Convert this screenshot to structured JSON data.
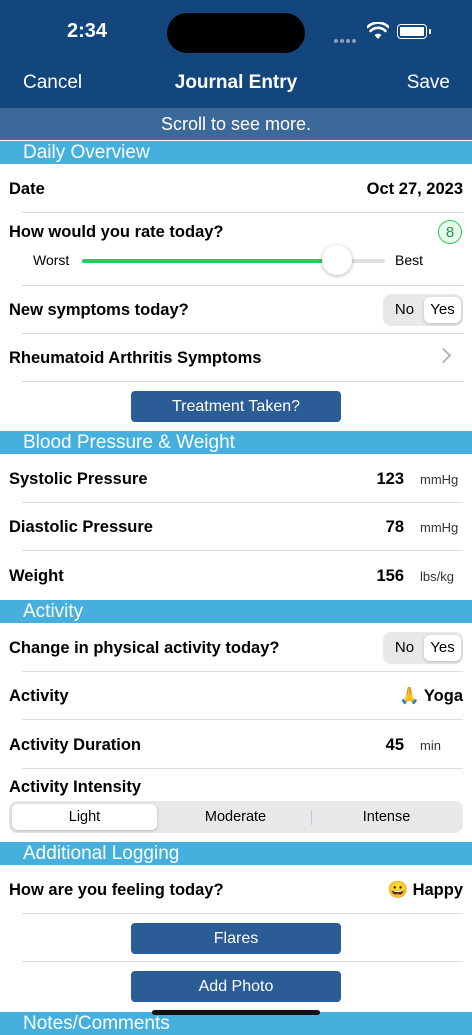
{
  "status": {
    "time": "2:34"
  },
  "nav": {
    "cancel": "Cancel",
    "title": "Journal Entry",
    "save": "Save"
  },
  "banner": "Scroll to see more.",
  "daily": {
    "header": "Daily Overview",
    "date_label": "Date",
    "date_value": "Oct 27, 2023",
    "rate_label": "How would you rate today?",
    "rating_value": "8",
    "rating_fraction": 0.84,
    "worst": "Worst",
    "best": "Best",
    "symptoms_label": "New symptoms today?",
    "symptoms_no": "No",
    "symptoms_yes": "Yes",
    "ra_label": "Rheumatoid Arthritis Symptoms",
    "treatment_button": "Treatment Taken?"
  },
  "bp": {
    "header": "Blood Pressure & Weight",
    "systolic_label": "Systolic Pressure",
    "systolic_value": "123",
    "systolic_unit": "mmHg",
    "diastolic_label": "Diastolic Pressure",
    "diastolic_value": "78",
    "diastolic_unit": "mmHg",
    "weight_label": "Weight",
    "weight_value": "156",
    "weight_unit": "lbs/kg"
  },
  "activity": {
    "header": "Activity",
    "change_label": "Change in physical activity today?",
    "change_no": "No",
    "change_yes": "Yes",
    "activity_label": "Activity",
    "activity_value": "🙏 Yoga",
    "duration_label": "Activity Duration",
    "duration_value": "45",
    "duration_unit": "min",
    "intensity_label": "Activity Intensity",
    "intensity_options": [
      "Light",
      "Moderate",
      "Intense"
    ]
  },
  "additional": {
    "header": "Additional Logging",
    "feeling_label": "How are you feeling today?",
    "feeling_value": "😀 Happy",
    "flares_button": "Flares",
    "photo_button": "Add Photo"
  },
  "notes": {
    "header": "Notes/Comments"
  },
  "colors": {
    "nav": "#13467c",
    "section": "#45b0de",
    "button": "#2b5c95",
    "accent_green": "#33c759"
  }
}
